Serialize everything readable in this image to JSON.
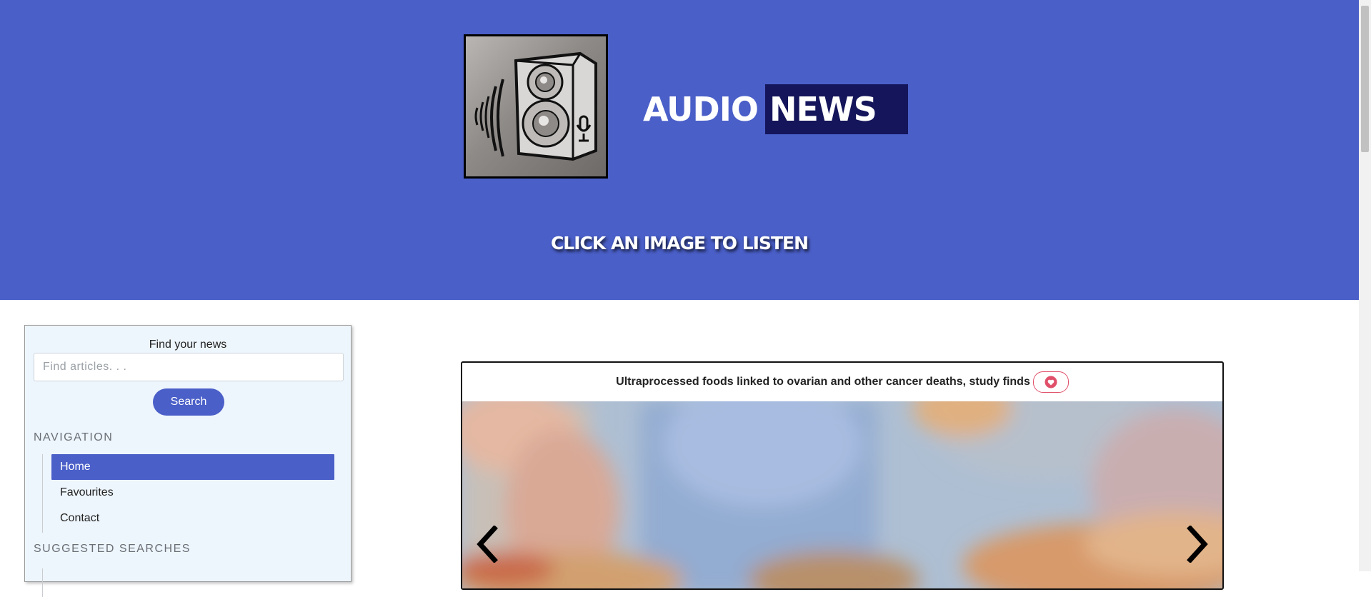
{
  "header": {
    "title_word1": "AUDIO",
    "title_word2": "NEWS",
    "call_to_action": "CLICK AN IMAGE TO LISTEN",
    "logo_icon": "speaker-with-microphone-logo"
  },
  "sidebar": {
    "find_label": "Find your news",
    "search_placeholder": "Find articles. . .",
    "search_value": "",
    "search_button": "Search",
    "navigation_heading": "NAVIGATION",
    "nav_items": [
      {
        "label": "Home",
        "active": true
      },
      {
        "label": "Favourites",
        "active": false
      },
      {
        "label": "Contact",
        "active": false
      }
    ],
    "suggested_heading": "SUGGESTED SEARCHES"
  },
  "article": {
    "headline": "Ultraprocessed foods linked to ovarian and other cancer deaths, study finds",
    "favourite_icon": "heart-icon",
    "prev_icon": "chevron-left-icon",
    "next_icon": "chevron-right-icon"
  },
  "colors": {
    "brand_blue": "#4a5fc8",
    "news_highlight": "#14155a",
    "sidebar_bg": "#eef6fd",
    "favourite_red": "#e0506a"
  }
}
